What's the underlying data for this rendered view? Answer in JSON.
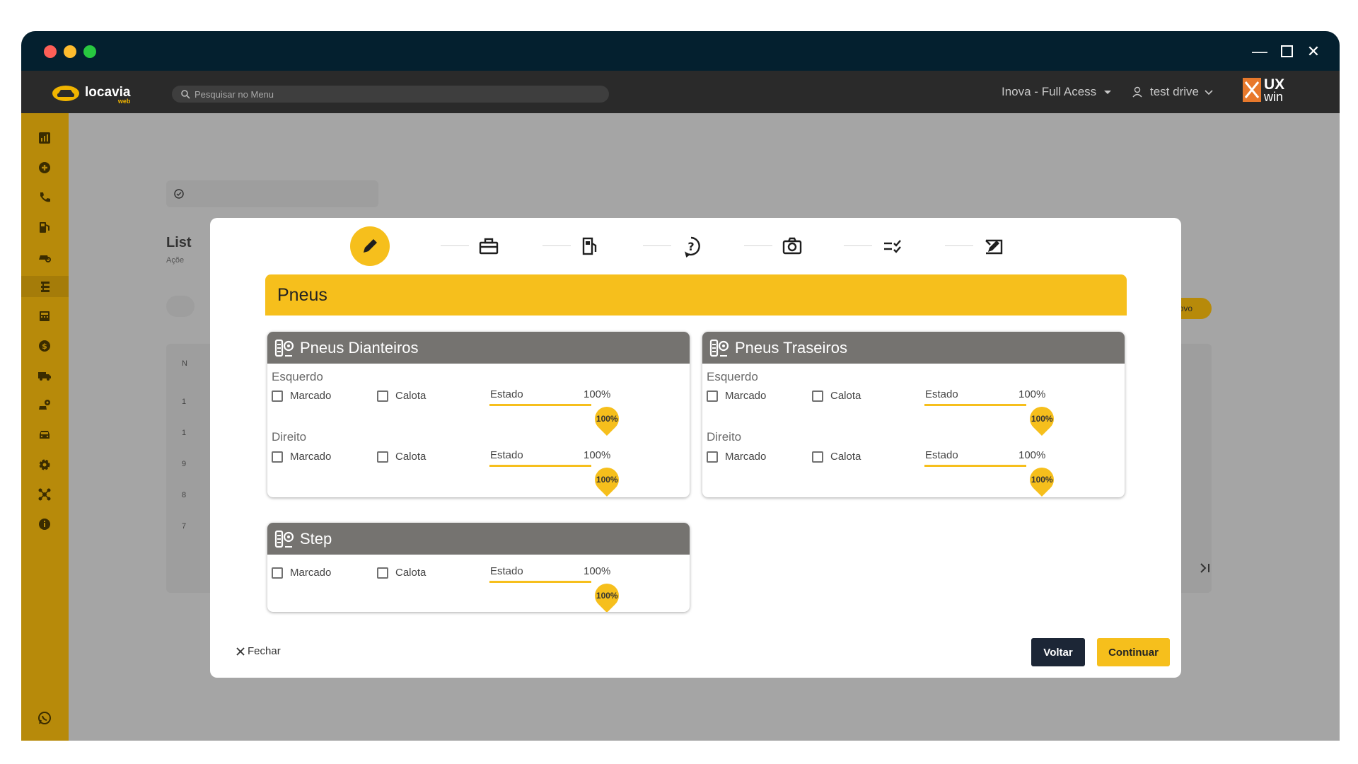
{
  "app": {
    "brand": "locavia",
    "brand_sub": "web",
    "search_placeholder": "Pesquisar no Menu",
    "org_label": "Inova - Full Acess",
    "user_label": "test drive",
    "partner_logo_line1": "UX",
    "partner_logo_line2": "win"
  },
  "background": {
    "title_partial": "List",
    "subtitle_partial": "Açõe",
    "new_button": "Novo",
    "row_numbers": [
      "1",
      "1",
      "9",
      "8",
      "7"
    ],
    "header_partial": "N"
  },
  "sidebar": {
    "items": [
      {
        "icon": "dashboard-icon"
      },
      {
        "icon": "add-circle-icon"
      },
      {
        "icon": "phone-icon"
      },
      {
        "icon": "fuel-pump-icon"
      },
      {
        "icon": "car-search-icon"
      },
      {
        "icon": "transfer-icon"
      },
      {
        "icon": "calculator-icon"
      },
      {
        "icon": "money-icon"
      },
      {
        "icon": "truck-icon"
      },
      {
        "icon": "car-key-icon"
      },
      {
        "icon": "car-icon"
      },
      {
        "icon": "settings-icon"
      },
      {
        "icon": "network-icon"
      },
      {
        "icon": "info-icon"
      },
      {
        "icon": "whatsapp-icon"
      }
    ]
  },
  "modal": {
    "steps": [
      {
        "icon": "pencil-icon",
        "current": true
      },
      {
        "icon": "toolbox-icon",
        "current": false
      },
      {
        "icon": "fuel-gauge-icon",
        "current": false
      },
      {
        "icon": "question-icon",
        "current": false
      },
      {
        "icon": "camera-icon",
        "current": false
      },
      {
        "icon": "checklist-icon",
        "current": false
      },
      {
        "icon": "signature-icon",
        "current": false
      }
    ],
    "section_title": "Pneus",
    "front": {
      "title": "Pneus Dianteiros",
      "left_label": "Esquerdo",
      "right_label": "Direito",
      "marcado": "Marcado",
      "calota": "Calota",
      "estado": "Estado",
      "left_value": "100%",
      "left_thumb": "100%",
      "right_value": "100%",
      "right_thumb": "100%",
      "left_level": 1.0,
      "right_level": 1.0
    },
    "rear": {
      "title": "Pneus Traseiros",
      "left_label": "Esquerdo",
      "right_label": "Direito",
      "marcado": "Marcado",
      "calota": "Calota",
      "estado": "Estado",
      "left_value": "100%",
      "left_thumb": "100%",
      "right_value": "100%",
      "right_thumb": "100%",
      "left_level": 1.0,
      "right_level": 1.0
    },
    "spare": {
      "title": "Step",
      "marcado": "Marcado",
      "calota": "Calota",
      "estado": "Estado",
      "value": "100%",
      "thumb": "100%",
      "level": 1.0
    },
    "close_label": "Fechar",
    "back_label": "Voltar",
    "continue_label": "Continuar"
  },
  "colors": {
    "accent": "#f6bf1c",
    "sidebar": "#b78a0a",
    "titlebar": "#04202f",
    "appbar": "#2a2a2a",
    "panel_header": "#757370",
    "dark_button": "#1c2636"
  }
}
